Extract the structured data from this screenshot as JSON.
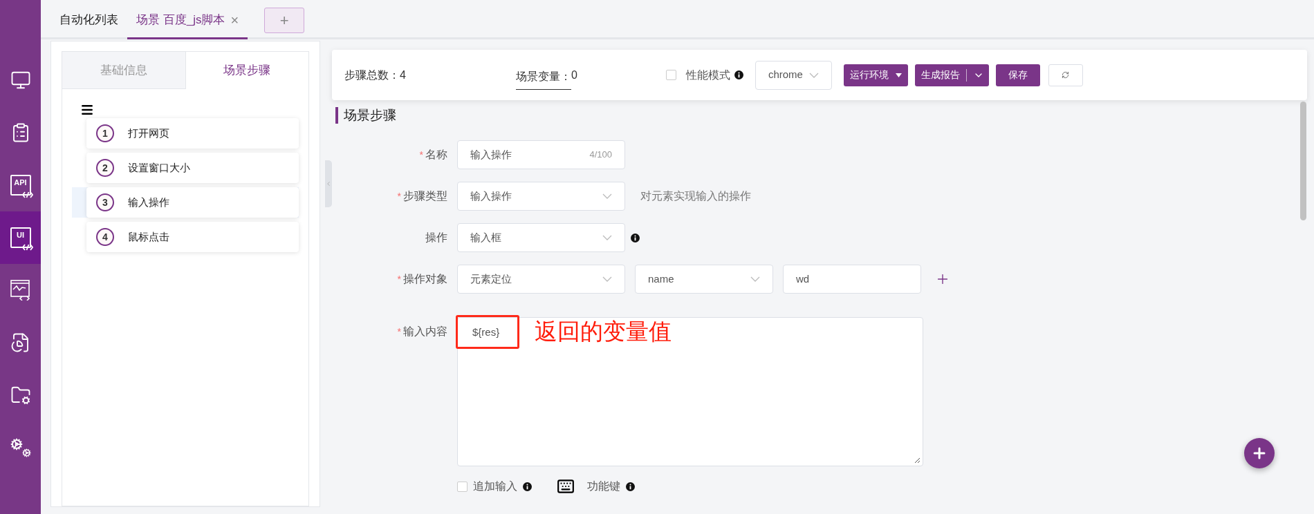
{
  "sidebar": {
    "items": [
      {
        "kind": "monitor",
        "selected": false
      },
      {
        "kind": "clipboard",
        "selected": false
      },
      {
        "kind": "api",
        "text": "API",
        "selected": false
      },
      {
        "kind": "ui",
        "text": "UI",
        "selected": true
      },
      {
        "kind": "monitor-chart",
        "selected": false
      },
      {
        "kind": "report",
        "selected": false
      },
      {
        "kind": "folder-gear",
        "selected": false
      },
      {
        "kind": "gears",
        "selected": false
      }
    ]
  },
  "tabs": [
    {
      "label": "自动化列表",
      "selected": false
    },
    {
      "label": "场景 百度_js脚本",
      "selected": true,
      "close": "×"
    }
  ],
  "add_tab": "+",
  "left_panel": {
    "tabs": [
      {
        "label": "基础信息",
        "selected": false
      },
      {
        "label": "场景步骤",
        "selected": true
      }
    ],
    "steps": [
      {
        "number": "1",
        "label": "打开网页",
        "selected": false
      },
      {
        "number": "2",
        "label": "设置窗口大小",
        "selected": false
      },
      {
        "number": "3",
        "label": "输入操作",
        "selected": true
      },
      {
        "number": "4",
        "label": "鼠标点击",
        "selected": false
      }
    ]
  },
  "toolbar": {
    "step_count": {
      "label": "步骤总数：",
      "value": "4"
    },
    "variables": {
      "label": "场景变量：",
      "value": "0"
    },
    "performance_mode": {
      "label": "性能模式",
      "checked": false
    },
    "browser": "chrome",
    "buttons": [
      {
        "kind": "dropdown",
        "label": "运行环境"
      },
      {
        "kind": "split",
        "label": "生成报告"
      },
      {
        "kind": "primary",
        "label": "保存"
      },
      {
        "kind": "refresh"
      }
    ]
  },
  "section_title": "场景步骤",
  "form": {
    "fields": [
      {
        "kind": "text",
        "label": "名称",
        "required_mark": "*",
        "value": "输入操作",
        "counter": "4/100"
      },
      {
        "kind": "select",
        "label": "步骤类型",
        "required_mark": "*",
        "value": "输入操作",
        "hint": "对元素实现输入的操作"
      },
      {
        "kind": "select",
        "label": "操作",
        "value": "输入框",
        "info": true
      },
      {
        "kind": "locator",
        "label": "操作对象",
        "required_mark": "*",
        "values": [
          "元素定位",
          "name",
          "wd"
        ]
      },
      {
        "kind": "textarea",
        "label": "输入内容",
        "required_mark": "*",
        "value": "${res}"
      }
    ],
    "options": [
      {
        "kind": "checkbox",
        "label": "追加输入",
        "checked": false
      },
      {
        "kind": "keyboard",
        "label": "功能键"
      }
    ]
  },
  "annotation": "返回的变量值"
}
